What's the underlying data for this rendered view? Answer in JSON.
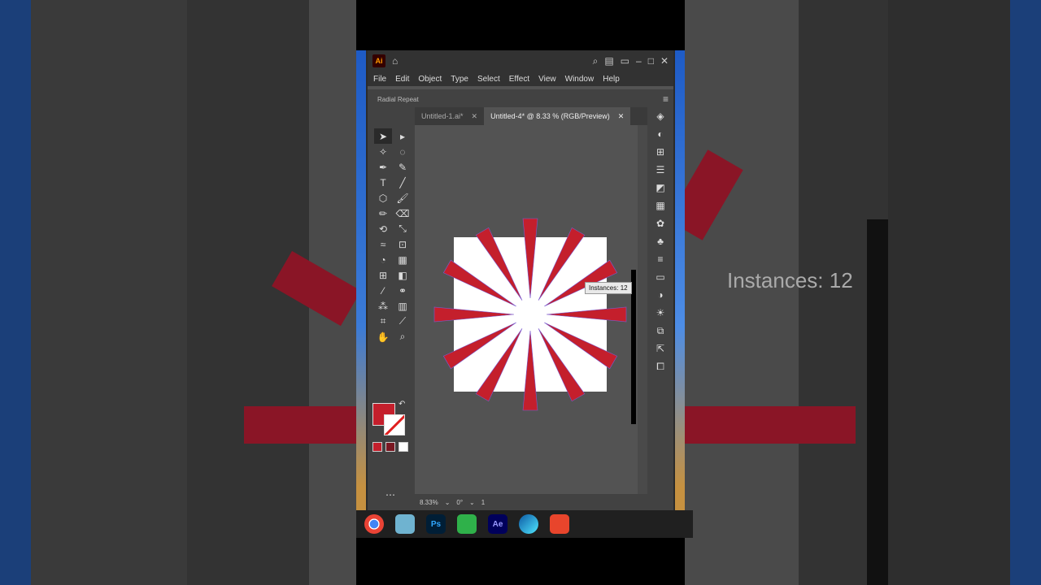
{
  "app": {
    "logo": "Ai",
    "window_controls": [
      "–",
      "□",
      "✕"
    ],
    "menu": [
      "File",
      "Edit",
      "Object",
      "Type",
      "Select",
      "Effect",
      "View",
      "Window",
      "Help"
    ],
    "control_bar_label": "Radial Repeat"
  },
  "documents": [
    {
      "title": "Untitled-1.ai*",
      "close": "✕",
      "active": false
    },
    {
      "title": "Untitled-4* @ 8.33 % (RGB/Preview)",
      "close": "✕",
      "active": true
    }
  ],
  "canvas": {
    "tooltip": "Instances: 12",
    "background_tooltip": "Instances: 12",
    "fill_color": "#c41f2c",
    "artboard_color": "#ffffff",
    "ray_count": 12
  },
  "status": {
    "zoom": "8.33%",
    "rotation": "0°",
    "artboard_number": "1"
  },
  "icons": {
    "tools": [
      "selection-icon",
      "direct-selection-icon",
      "magic-wand-icon",
      "lasso-icon",
      "pen-icon",
      "curvature-icon",
      "type-icon",
      "line-icon",
      "ellipse-icon",
      "paintbrush-icon",
      "pencil-icon",
      "eraser-icon",
      "rotate-icon",
      "scale-icon",
      "warp-icon",
      "free-transform-icon",
      "shape-builder-icon",
      "perspective-icon",
      "mesh-icon",
      "gradient-icon",
      "eyedropper-icon",
      "blend-icon",
      "symbol-sprayer-icon",
      "graph-icon",
      "artboard-icon",
      "slice-icon",
      "hand-icon",
      "zoom-icon"
    ],
    "panels": [
      "layers-icon",
      "color-icon",
      "transform-icon",
      "align-icon",
      "pathfinder-icon",
      "swatches-icon",
      "brushes-icon",
      "symbols-icon",
      "stroke-icon",
      "gradient-icon",
      "transparency-icon",
      "appearance-icon",
      "graphic-styles-icon",
      "asset-export-icon",
      "artboards-icon",
      "links-icon"
    ],
    "taskbar": [
      "chrome-icon",
      "files-icon",
      "photoshop-icon",
      "camtasia-icon",
      "after-effects-icon",
      "edge-icon",
      "recorder-icon"
    ]
  },
  "taskbar": {
    "photoshop": "Ps",
    "after_effects": "Ae"
  }
}
